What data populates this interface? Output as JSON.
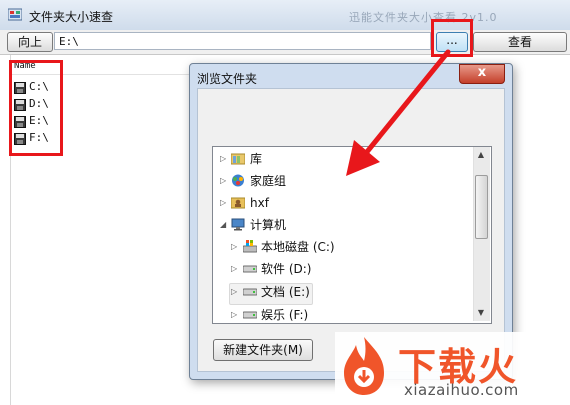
{
  "window": {
    "title": "文件夹大小速查",
    "ghost_title": "迅能文件夹大小查看 2v1.0"
  },
  "toolbar": {
    "up_label": "向上",
    "path_value": "E:\\",
    "browse_label": "...",
    "view_label": "查看"
  },
  "list": {
    "column_header": "Name",
    "drives": [
      "C:\\",
      "D:\\",
      "E:\\",
      "F:\\"
    ]
  },
  "dialog": {
    "title": "浏览文件夹",
    "close_label": "x",
    "tree": [
      {
        "label": "库",
        "icon": "library-icon"
      },
      {
        "label": "家庭组",
        "icon": "homegroup-icon"
      },
      {
        "label": "hxf",
        "icon": "user-folder-icon"
      },
      {
        "label": "计算机",
        "icon": "computer-icon"
      },
      {
        "label": "本地磁盘 (C:)",
        "icon": "system-drive-icon"
      },
      {
        "label": "软件 (D:)",
        "icon": "drive-icon"
      },
      {
        "label": "文档 (E:)",
        "icon": "drive-icon"
      },
      {
        "label": "娱乐 (F:)",
        "icon": "drive-icon"
      }
    ],
    "new_folder_label": "新建文件夹(M)"
  },
  "watermark": {
    "brand": "下载火",
    "url": "xiazaihuo.com"
  },
  "colors": {
    "highlight_red": "#e8171b",
    "watermark_orange": "#f0552a"
  }
}
